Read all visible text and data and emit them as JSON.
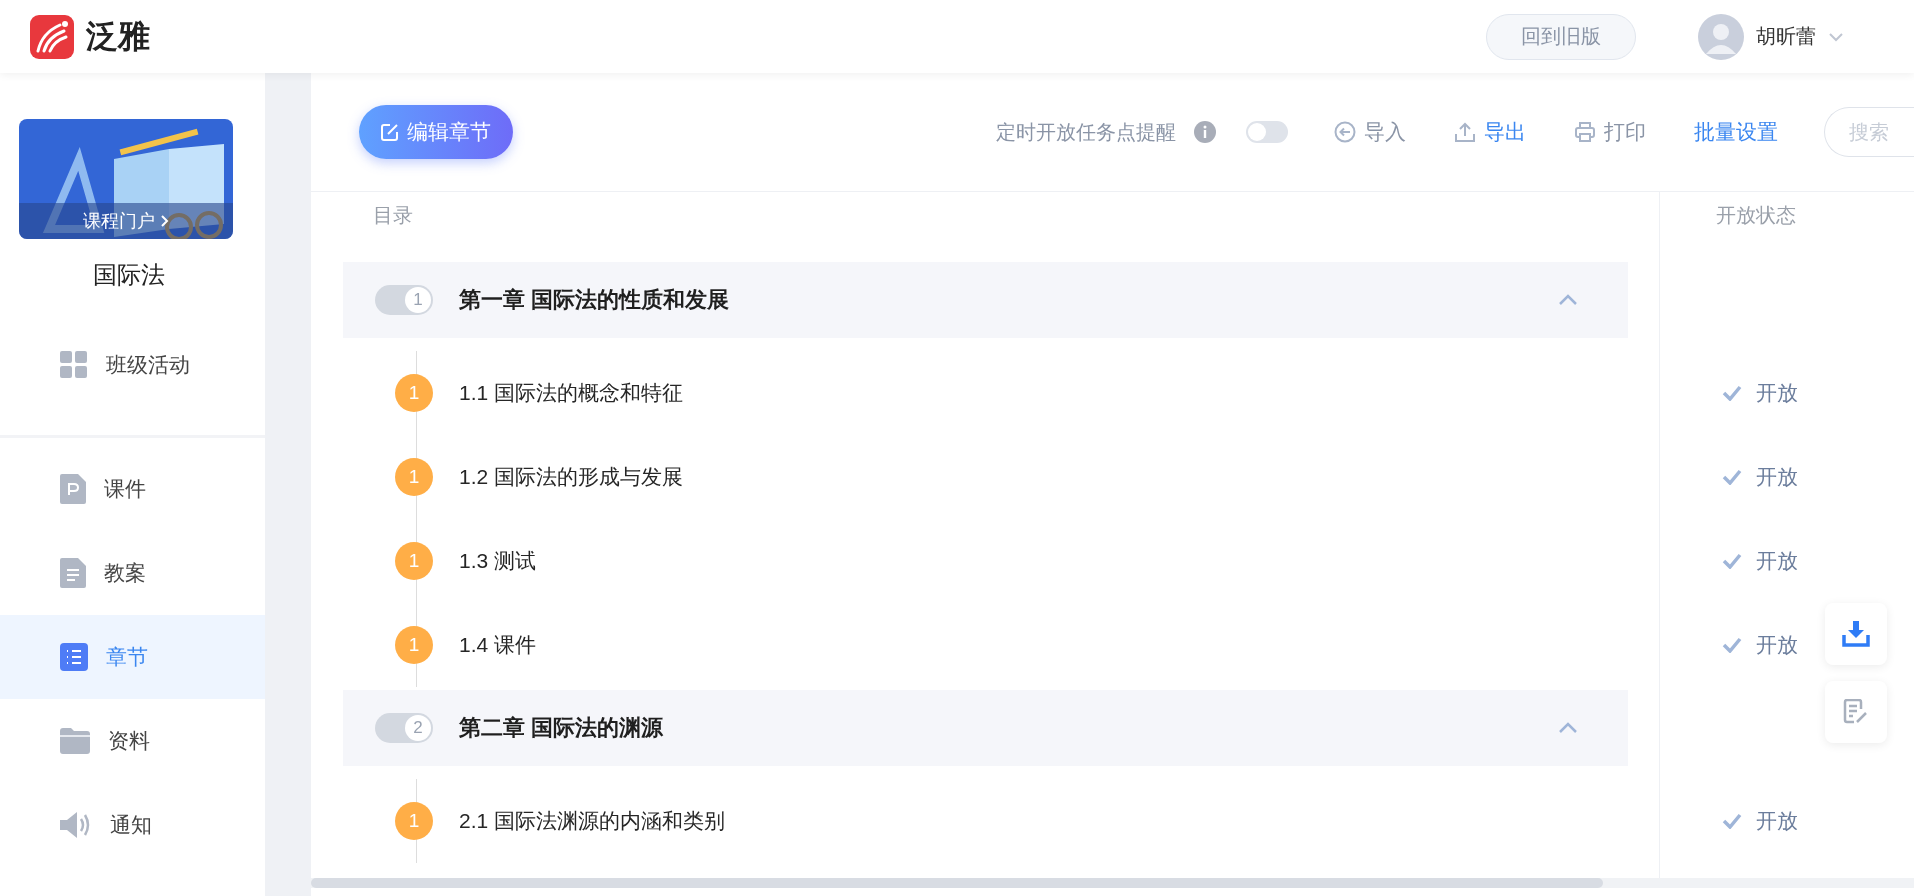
{
  "header": {
    "logo_text": "泛雅",
    "old_version_button": "回到旧版",
    "user_name": "胡昕蕾"
  },
  "sidebar": {
    "course_card_link": "课程门户",
    "course_name": "国际法",
    "top_items": [
      {
        "label": "班级活动",
        "kind": "grid",
        "selected": false
      }
    ],
    "items": [
      {
        "label": "课件",
        "kind": "ppt",
        "selected": false
      },
      {
        "label": "教案",
        "kind": "doc",
        "selected": false
      },
      {
        "label": "章节",
        "kind": "list",
        "selected": true
      },
      {
        "label": "资料",
        "kind": "folder",
        "selected": false
      },
      {
        "label": "通知",
        "kind": "speaker",
        "selected": false
      }
    ]
  },
  "toolbar": {
    "edit_button": "编辑章节",
    "reminder_label": "定时开放任务点提醒",
    "reminder_on": false,
    "import": "导入",
    "export": "导出",
    "print": "打印",
    "batch_settings": "批量设置",
    "search": {
      "placeholder": "搜索"
    }
  },
  "table": {
    "columns": [
      "目录",
      "开放状态"
    ],
    "chapters": [
      {
        "number": "1",
        "title": "第一章 国际法的性质和发展",
        "expanded": true,
        "sections": [
          {
            "badge": "1",
            "title": "1.1 国际法的概念和特征",
            "status": "开放"
          },
          {
            "badge": "1",
            "title": "1.2 国际法的形成与发展",
            "status": "开放"
          },
          {
            "badge": "1",
            "title": "1.3 测试",
            "status": "开放"
          },
          {
            "badge": "1",
            "title": "1.4 课件",
            "status": "开放"
          }
        ]
      },
      {
        "number": "2",
        "title": "第二章 国际法的渊源",
        "expanded": true,
        "sections": [
          {
            "badge": "1",
            "title": "2.1 国际法渊源的内涵和类别",
            "status": "开放"
          }
        ]
      }
    ]
  }
}
